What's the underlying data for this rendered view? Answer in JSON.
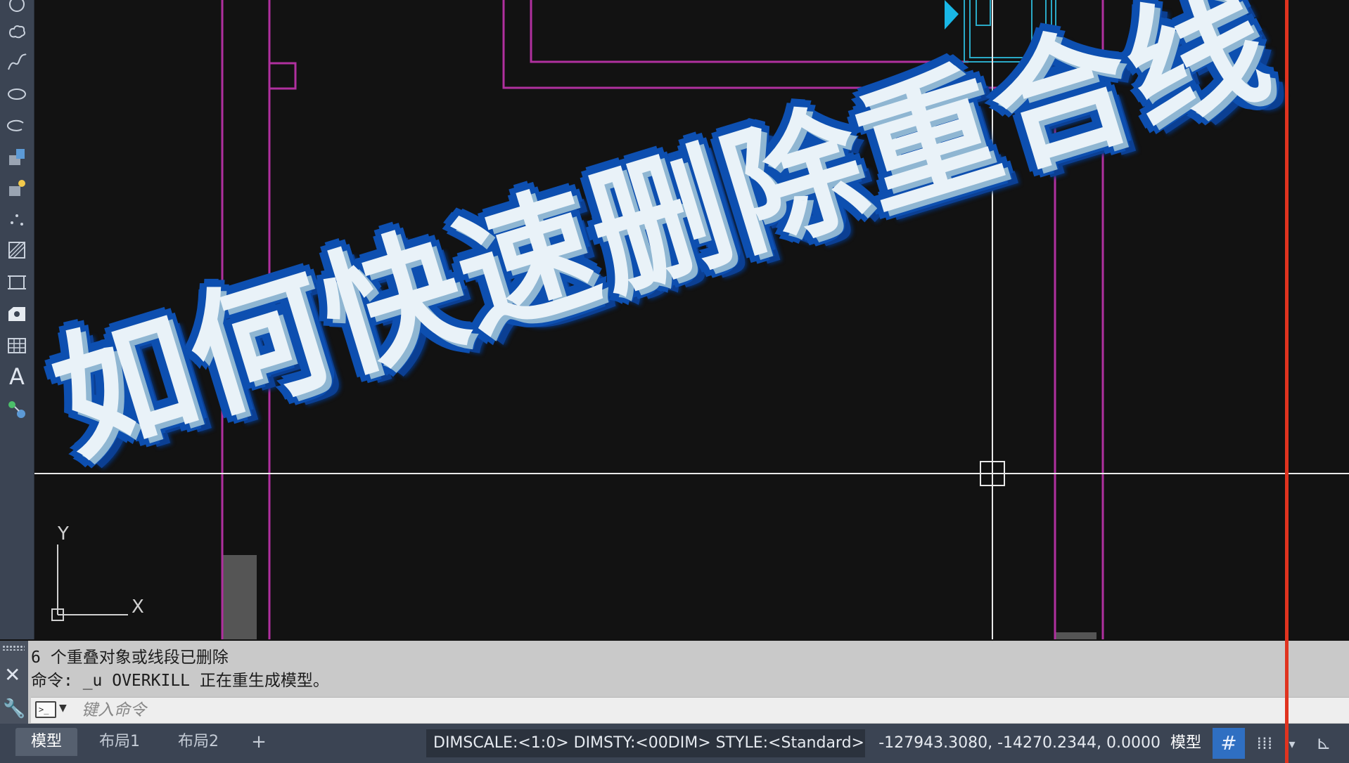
{
  "title_overlay": "如何快速删除重合线",
  "toolbar": {
    "items": [
      "circle-icon",
      "revcloud-icon",
      "spline-icon",
      "ellipse-icon",
      "ellipse-arc-icon",
      "insert-block-icon",
      "make-block-icon",
      "point-icon",
      "hatch-icon",
      "region-icon",
      "wipeout-icon",
      "table-icon",
      "text-icon",
      "add-selected-icon"
    ],
    "text_tool": "A"
  },
  "canvas": {
    "ucs_y_label": "Y",
    "ucs_x_label": "X",
    "colors": {
      "magenta": "#b0309f",
      "cyan": "#2aa9c6",
      "crosshair": "#e8e8e8",
      "red": "#e0331f"
    }
  },
  "command": {
    "history": [
      "6 个重叠对象或线段已删除",
      "命令: _u OVERKILL 正在重生成模型。"
    ],
    "input_value": "",
    "input_placeholder": "键入命令",
    "prompt_icon": ">_"
  },
  "status": {
    "tabs": [
      "模型",
      "布局1",
      "布局2"
    ],
    "add_tab": "+",
    "dims": "DIMSCALE:<1:0> DIMSTY:<00DIM> STYLE:<Standard>",
    "coords": "-127943.3080, -14270.2344, 0.0000",
    "model_label": "模型",
    "grid_symbol": "#",
    "snap_symbol": "⁞⁞⁞",
    "dropdown_symbol": "▾",
    "extra_symbol": "⊾"
  }
}
